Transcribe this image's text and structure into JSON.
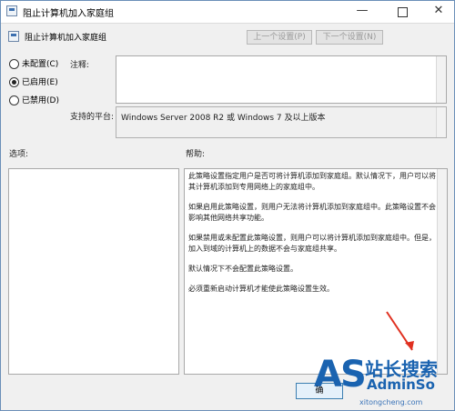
{
  "window": {
    "title": "阻止计算机加入家庭组",
    "minimize_glyph": "—",
    "close_glyph": "✕"
  },
  "header": {
    "policy_title": "阻止计算机加入家庭组",
    "prev_button": "上一个设置(P)",
    "next_button": "下一个设置(N)"
  },
  "radios": [
    {
      "label": "未配置(C)",
      "checked": false
    },
    {
      "label": "已启用(E)",
      "checked": true
    },
    {
      "label": "已禁用(D)",
      "checked": false
    }
  ],
  "comment": {
    "label": "注释:",
    "value": ""
  },
  "platform": {
    "label": "支持的平台:",
    "value": "Windows Server 2008 R2 或 Windows 7 及以上版本"
  },
  "options": {
    "label": "选项:"
  },
  "help": {
    "label": "帮助:",
    "paragraphs": [
      "此策略设置指定用户是否可将计算机添加到家庭组。默认情况下，用户可以将其计算机添加到专用网络上的家庭组中。",
      "如果启用此策略设置，则用户无法将计算机添加到家庭组中。此策略设置不会影响其他网络共享功能。",
      "如果禁用或未配置此策略设置，则用户可以将计算机添加到家庭组中。但是，加入到域的计算机上的数据不会与家庭组共享。",
      "默认情况下不会配置此策略设置。",
      "必须重新启动计算机才能使此策略设置生效。"
    ]
  },
  "buttons": {
    "ok": "确"
  },
  "watermark": {
    "logo": "AS",
    "cn": "站长搜索",
    "brand": "AdminSo",
    "url": "xitongcheng.com"
  }
}
